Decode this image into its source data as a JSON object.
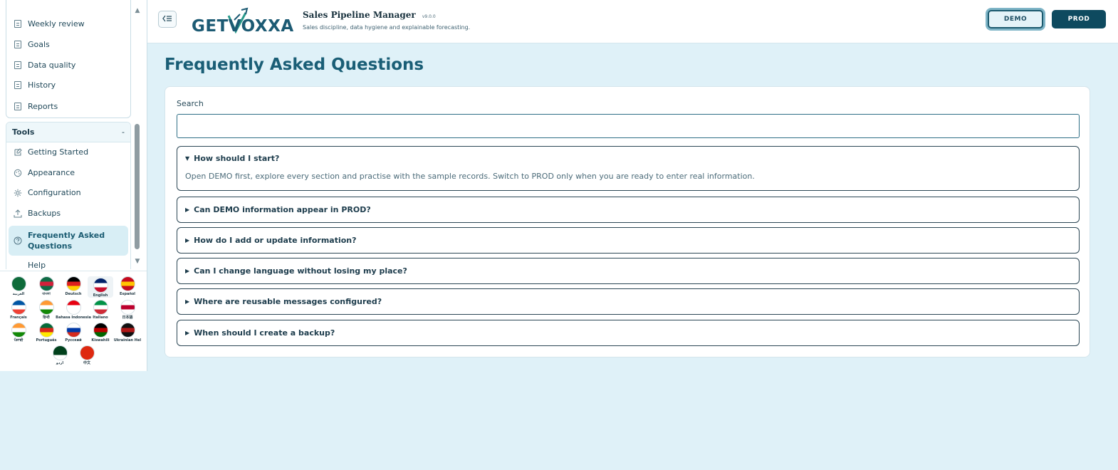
{
  "sidebar": {
    "reports_group": {
      "items": [
        {
          "label": "Weekly review"
        },
        {
          "label": "Goals"
        },
        {
          "label": "Data quality"
        },
        {
          "label": "History"
        },
        {
          "label": "Reports"
        }
      ]
    },
    "tools_group": {
      "title": "Tools",
      "toggle": "-",
      "items": [
        {
          "label": "Getting Started",
          "icon": "sparkle-edit-icon"
        },
        {
          "label": "Appearance",
          "icon": "palette-icon"
        },
        {
          "label": "Configuration",
          "icon": "gear-icon"
        },
        {
          "label": "Backups",
          "icon": "upload-icon"
        },
        {
          "label": "Frequently Asked Questions",
          "icon": "question-icon",
          "active": true
        },
        {
          "label": "Help",
          "icon": "help-icon"
        }
      ]
    },
    "languages": [
      {
        "label": "العربية",
        "colors": [
          "#0e6b3a",
          "#0e6b3a",
          "#0e6b3a"
        ]
      },
      {
        "label": "বাংলা",
        "colors": [
          "#0f6b45",
          "#d3203a",
          "#0f6b45"
        ]
      },
      {
        "label": "Deutsch",
        "colors": [
          "#000000",
          "#dd1f1f",
          "#ffce00"
        ]
      },
      {
        "label": "English",
        "colors": [
          "#012169",
          "#ffffff",
          "#c8102e"
        ],
        "selected": true
      },
      {
        "label": "Español",
        "colors": [
          "#c60b1e",
          "#ffc400",
          "#c60b1e"
        ]
      },
      {
        "label": "Français",
        "colors": [
          "#0055a4",
          "#ffffff",
          "#ef4135"
        ]
      },
      {
        "label": "हिन्दी",
        "colors": [
          "#ff9933",
          "#ffffff",
          "#138808"
        ]
      },
      {
        "label": "Bahasa Indonesia",
        "colors": [
          "#e70011",
          "#ffffff",
          "#ffffff"
        ]
      },
      {
        "label": "Italiano",
        "colors": [
          "#009246",
          "#ffffff",
          "#ce2b37"
        ]
      },
      {
        "label": "日本語",
        "colors": [
          "#ffffff",
          "#bc002d",
          "#ffffff"
        ]
      },
      {
        "label": "ਪੰਜਾਬੀ",
        "colors": [
          "#ff9933",
          "#ffffff",
          "#138808"
        ]
      },
      {
        "label": "Português",
        "colors": [
          "#046a38",
          "#da291c",
          "#ffe900"
        ]
      },
      {
        "label": "Русский",
        "colors": [
          "#ffffff",
          "#0039a6",
          "#d52b1e"
        ]
      },
      {
        "label": "Kiswahili",
        "colors": [
          "#000000",
          "#bb0000",
          "#006600"
        ]
      },
      {
        "label": "Ukrainian Hel",
        "colors": [
          "#111111",
          "#b01818",
          "#111111"
        ]
      },
      {
        "label": "اردو",
        "colors": [
          "#01411c",
          "#01411c",
          "#ffffff"
        ]
      },
      {
        "label": "中文",
        "colors": [
          "#de2910",
          "#de2910",
          "#de2910"
        ]
      }
    ]
  },
  "header": {
    "logo_text": "GETVOXXA",
    "app_title": "Sales Pipeline Manager",
    "version": "v9.0.0",
    "tagline": "Sales discipline, data hygiene and explainable forecasting.",
    "demo_label": "DEMO",
    "prod_label": "PROD",
    "accent": "#0e4a5f"
  },
  "main": {
    "title": "Frequently Asked Questions",
    "search": {
      "label": "Search",
      "placeholder": "",
      "value": ""
    },
    "faqs": [
      {
        "question": "How should I start?",
        "expanded": true,
        "answer": "Open DEMO first, explore every section and practise with the sample records. Switch to PROD only when you are ready to enter real information."
      },
      {
        "question": "Can DEMO information appear in PROD?",
        "expanded": false
      },
      {
        "question": "How do I add or update information?",
        "expanded": false
      },
      {
        "question": "Can I change language without losing my place?",
        "expanded": false
      },
      {
        "question": "Where are reusable messages configured?",
        "expanded": false
      },
      {
        "question": "When should I create a backup?",
        "expanded": false
      }
    ]
  }
}
